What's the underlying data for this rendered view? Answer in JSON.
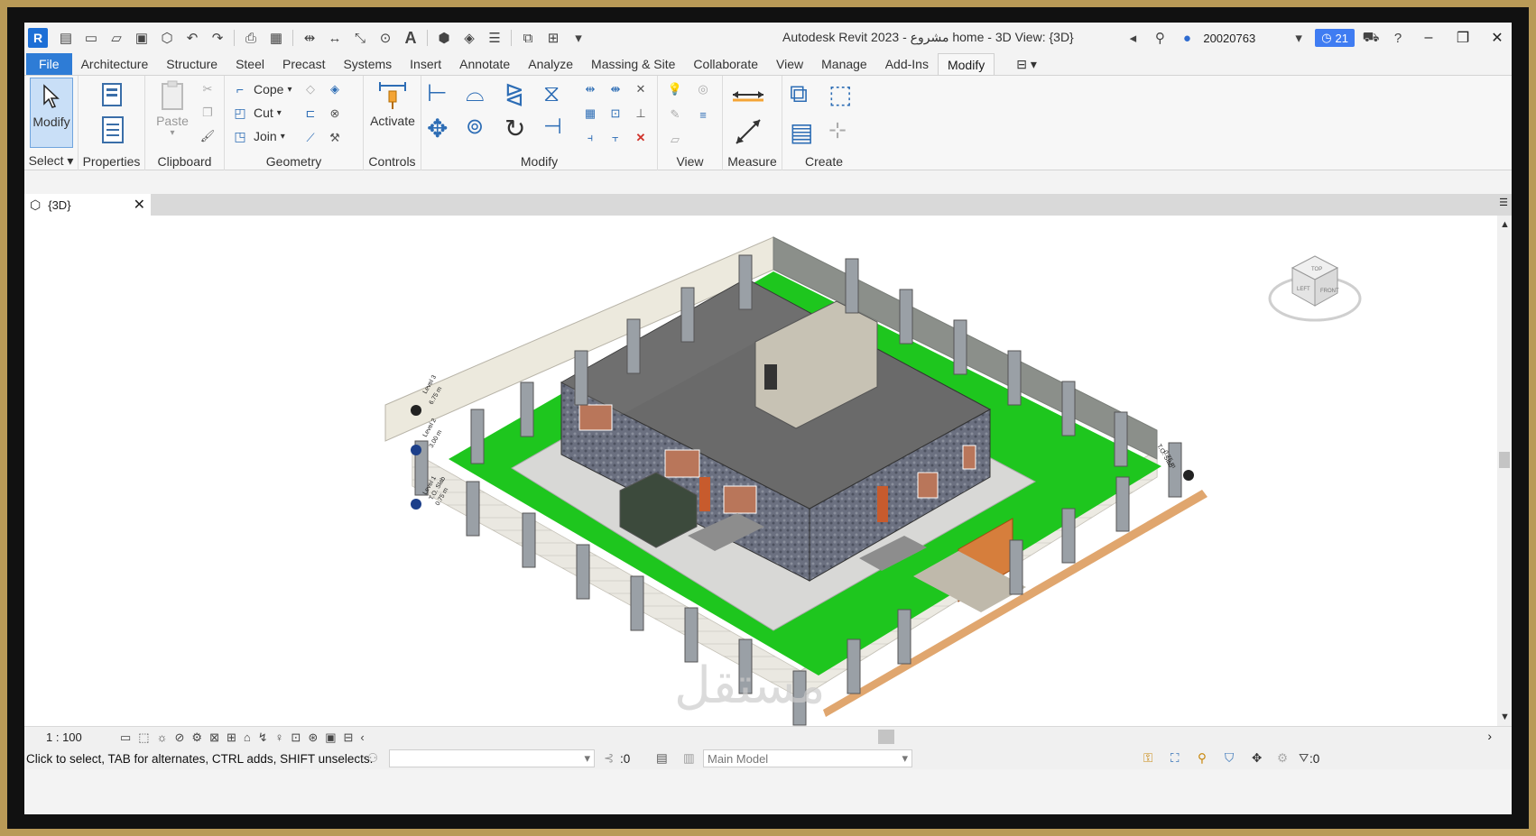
{
  "titlebar": {
    "app_logo": "R",
    "title": "Autodesk Revit 2023 - مشروع home - 3D View: {3D}",
    "user_id": "20020763",
    "trial_badge": "21"
  },
  "tabs": [
    {
      "label": "File"
    },
    {
      "label": "Architecture"
    },
    {
      "label": "Structure"
    },
    {
      "label": "Steel"
    },
    {
      "label": "Precast"
    },
    {
      "label": "Systems"
    },
    {
      "label": "Insert"
    },
    {
      "label": "Annotate"
    },
    {
      "label": "Analyze"
    },
    {
      "label": "Massing & Site"
    },
    {
      "label": "Collaborate"
    },
    {
      "label": "View"
    },
    {
      "label": "Manage"
    },
    {
      "label": "Add-Ins"
    },
    {
      "label": "Modify"
    }
  ],
  "ribbon": {
    "select": {
      "button": "Modify",
      "label": "Select"
    },
    "properties": {
      "label": "Properties"
    },
    "clipboard": {
      "paste": "Paste",
      "label": "Clipboard"
    },
    "geometry": {
      "cope": "Cope",
      "cut": "Cut",
      "join": "Join",
      "label": "Geometry"
    },
    "controls": {
      "button": "Activate",
      "label": "Controls"
    },
    "modify": {
      "label": "Modify"
    },
    "view": {
      "label": "View"
    },
    "measure": {
      "label": "Measure"
    },
    "create": {
      "label": "Create"
    }
  },
  "view_tab": {
    "label": "{3D}"
  },
  "model": {
    "level_tags": [
      "Level 3",
      "6.75 m",
      "Level 2",
      "3.00 m",
      "Level 1",
      "T.O. Slab",
      "0.75 m"
    ],
    "right_tag": [
      "T.O. Slab",
      "0.75 m"
    ],
    "viewcube_faces": [
      "TOP",
      "LEFT",
      "FRONT"
    ]
  },
  "statusbar": {
    "scale": "1 : 100",
    "hint": "Click to select, TAB for alternates, CTRL adds, SHIFT unselects.",
    "selection_count": ":0",
    "model_dropdown": "Main Model",
    "filter_count": ":0"
  },
  "watermark": "مستقل"
}
